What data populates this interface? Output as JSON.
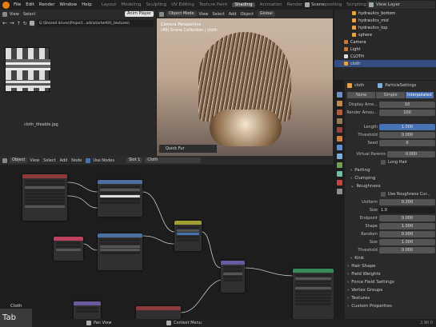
{
  "topbar": {
    "menus": [
      "File",
      "Edit",
      "Render",
      "Window",
      "Help"
    ],
    "workspaces": [
      "Layout",
      "Modeling",
      "Sculpting",
      "UV Editing",
      "Texture Paint",
      "Shading",
      "Animation",
      "Rendering",
      "Compositing",
      "Scripting"
    ],
    "active_workspace": "Shading",
    "scene": "Scene",
    "view_layer": "View Layer"
  },
  "image_editor": {
    "menus": [
      "View",
      "Select"
    ],
    "player": "Anim Player",
    "path": "G:\\Shared drives\\Project...ads\\starterKit\\_textures\\",
    "image_name": "cloth_tileable.jpg"
  },
  "viewport": {
    "mode": "Object Mode",
    "menus": [
      "View",
      "Select",
      "Add",
      "Object"
    ],
    "orientation": "Global",
    "camera_text": "Camera Perspective",
    "collection_text": "(49) Scene Collection | cloth",
    "panel": "Quick Fur"
  },
  "outliner": {
    "items": [
      {
        "name": "hydraulics_bottom",
        "color": "#e8a340"
      },
      {
        "name": "hydraulics_mid",
        "color": "#e8a340"
      },
      {
        "name": "hydraulics_top",
        "color": "#e8a340"
      },
      {
        "name": "sphere",
        "color": "#e8a340"
      },
      {
        "name": "Camera",
        "color": "#c27b3c"
      },
      {
        "name": "Light",
        "color": "#c27b3c"
      },
      {
        "name": "CLOTH",
        "color": "#dddddd"
      },
      {
        "name": "cloth",
        "color": "#e8a340",
        "selected": true
      }
    ]
  },
  "properties": {
    "object": "cloth",
    "settings": "ParticleSettings",
    "tabs": [
      "None",
      "Simple",
      "Interpolated"
    ],
    "active_tab": "Interpolated",
    "rows1": [
      {
        "label": "Display Ame...",
        "value": "10"
      },
      {
        "label": "Render Amou...",
        "value": "100"
      }
    ],
    "rows2": [
      {
        "label": "Length",
        "value": "1.000",
        "blue": true
      },
      {
        "label": "Threshold",
        "value": "0.000"
      },
      {
        "label": "Seed",
        "value": "0"
      }
    ],
    "virtual_parents": {
      "label": "Virtual Parents",
      "value": "0.000"
    },
    "long_hair": "Long Hair",
    "sections": [
      "Parting",
      "Clumping",
      "Roughness"
    ],
    "use_roughness": "Use Roughness Cur...",
    "rough_rows": [
      {
        "label": "Uniform",
        "value": "0.200"
      },
      {
        "label": "Size",
        "value": "1.0"
      },
      {
        "label": "Endpoint",
        "value": "0.000"
      },
      {
        "label": "Shape",
        "value": "1.000"
      },
      {
        "label": "Random",
        "value": "0.000"
      },
      {
        "label": "Size",
        "value": "1.000"
      },
      {
        "label": "Threshold",
        "value": "0.000"
      }
    ],
    "kink": "Kink",
    "more_sections": [
      "Hair Shape",
      "Field Weights",
      "Force Field Settings",
      "Vertex Groups",
      "Textures",
      "Custom Properties"
    ]
  },
  "node_editor": {
    "type": "Object",
    "menus": [
      "View",
      "Select",
      "Add",
      "Node"
    ],
    "use_nodes": "Use Nodes",
    "slot": "Slot 1",
    "material": "Cloth",
    "label": "Cloth"
  },
  "status": {
    "key": "Tab",
    "pan": "Pan View",
    "context": "Context Menu",
    "version": "2.90.0"
  }
}
